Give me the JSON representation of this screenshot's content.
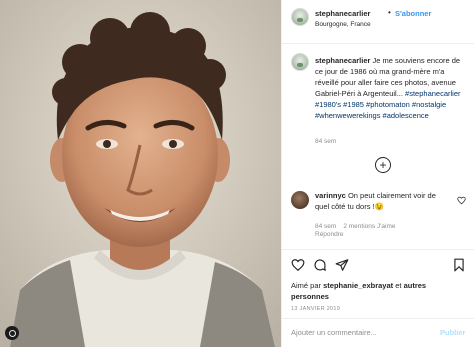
{
  "post": {
    "username": "stephanecarlier",
    "separator": "•",
    "follow_label": "S'abonner",
    "location": "Bourgogne, France"
  },
  "caption": {
    "username": "stephanecarlier",
    "text": " Je me souviens encore de ce jour de 1986 où ma grand-mère m'a réveillé pour aller faire ces photos, avenue Gabriel-Péri à Argenteuil... ",
    "hashtags": "#stephanecarlier #1980's #1985 #photomaton #nostalgie #whenwewerekings #adolescence",
    "time": "84 sem"
  },
  "load_more": {
    "icon": "plus-circle-icon",
    "glyph": "+"
  },
  "comment": {
    "username": "varinnyc",
    "text": " On peut clairement voir de quel côté tu dors !😉",
    "time": "84 sem",
    "likes": "2 mentions J'aime",
    "reply": "Répondre"
  },
  "actions": {
    "like_icon": "heart-icon",
    "comment_icon": "comment-icon",
    "share_icon": "paper-plane-icon",
    "save_icon": "bookmark-icon"
  },
  "likes": {
    "prefix": "Aimé par ",
    "user": "stephanie_exbrayat",
    "middle": " et ",
    "others": "autres personnes"
  },
  "date": "13 JANVIER 2019",
  "add_comment": {
    "placeholder": "Ajouter un commentaire...",
    "publish_label": "Publier"
  },
  "colors": {
    "link_blue": "#3897f0",
    "hashtag": "#00376b",
    "muted": "#8e8e8e",
    "publish_disabled": "#b2dffc"
  }
}
